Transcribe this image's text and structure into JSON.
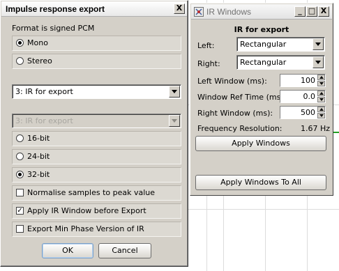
{
  "export_dialog": {
    "title": "Impulse response export",
    "close_glyph": "X",
    "format_label": "Format is signed PCM",
    "channel_options": [
      "Mono",
      "Stereo"
    ],
    "channel_selected": "Mono",
    "source_selected": "3: IR for export",
    "second_source_selected": "3: IR for export",
    "bit_depth_options": [
      "16-bit",
      "24-bit",
      "32-bit"
    ],
    "bit_depth_selected": "32-bit",
    "normalise_label": "Normalise samples to peak value",
    "normalise_checked": false,
    "apply_window_label": "Apply IR Window before Export",
    "apply_window_checked": true,
    "min_phase_label": "Export Min Phase Version of IR",
    "min_phase_checked": false,
    "ok_label": "OK",
    "cancel_label": "Cancel"
  },
  "ir_windows": {
    "title": "IR Windows",
    "heading": "IR for export",
    "left_label": "Left:",
    "left_value": "Rectangular",
    "right_label": "Right:",
    "right_value": "Rectangular",
    "left_window_label": "Left Window (ms):",
    "left_window_value": "100",
    "ref_time_label": "Window Ref Time (ms):",
    "ref_time_value": "0.0",
    "right_window_label": "Right Window (ms):",
    "right_window_value": "500",
    "freq_res_label": "Frequency Resolution:",
    "freq_res_value": "1.67 Hz",
    "apply_label": "Apply Windows",
    "apply_all_label": "Apply Windows To All",
    "minimize_glyph": "_",
    "maximize_glyph": "□",
    "close_glyph": "X"
  },
  "colors": {
    "dialog_bg": "#d4d0c8",
    "trace_green": "#22a022",
    "grid": "#dcdcdc"
  }
}
